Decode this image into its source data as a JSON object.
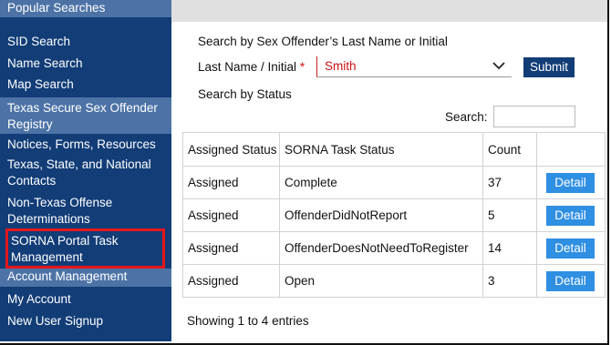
{
  "sidebar": {
    "header_popular": "Popular Searches",
    "items_popular": [
      "SID Search",
      "Name Search",
      "Map Search"
    ],
    "header_registry": "Texas Secure Sex Offender Registry",
    "items_registry": [
      "Notices, Forms, Resources",
      "Texas, State, and National Contacts",
      "Non-Texas Offense Determinations",
      "SORNA Portal Task Management"
    ],
    "header_account": "Account Management",
    "items_account": [
      "My Account",
      "New User Signup"
    ]
  },
  "search": {
    "heading": "Search by Sex Offender’s Last Name or Initial",
    "field_label": "Last Name / Initial",
    "required_mark": "*",
    "field_value": "Smith",
    "submit_label": "Submit",
    "status_heading": "Search by Status",
    "table_search_label": "Search:",
    "table_search_value": ""
  },
  "table": {
    "headers": [
      "Assigned Status",
      "SORNA Task Status",
      "Count",
      ""
    ],
    "rows": [
      {
        "assigned": "Assigned",
        "status": "Complete",
        "count": "37",
        "action": "Detail"
      },
      {
        "assigned": "Assigned",
        "status": "OffenderDidNotReport",
        "count": "5",
        "action": "Detail"
      },
      {
        "assigned": "Assigned",
        "status": "OffenderDoesNotNeedToRegister",
        "count": "14",
        "action": "Detail"
      },
      {
        "assigned": "Assigned",
        "status": "Open",
        "count": "3",
        "action": "Detail"
      }
    ],
    "footer": "Showing 1 to 4 entries"
  },
  "colors": {
    "sidebar_bg": "#123d77",
    "section_header_bg": "#4d73a6",
    "highlight_border": "#e5161c",
    "detail_button": "#2f8fe2",
    "required": "#cc1111"
  },
  "icons": {
    "dropdown": "chevron-down-icon"
  }
}
